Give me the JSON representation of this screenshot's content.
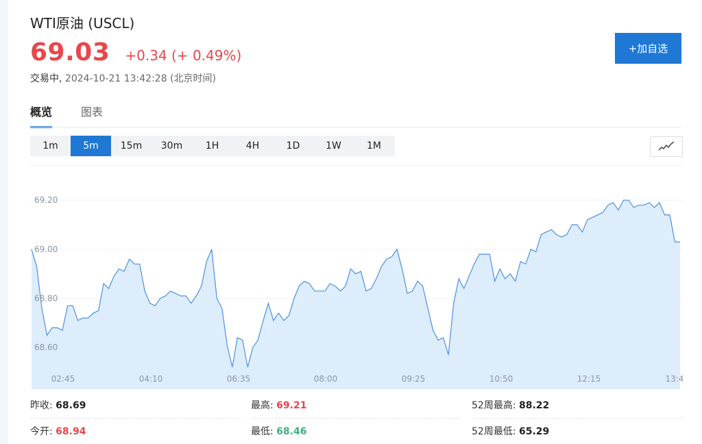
{
  "header": {
    "title": "WTI原油 (USCL)",
    "price": "69.03",
    "change": "+0.34 (+ 0.49%)",
    "status_label": "交易中,",
    "timestamp": "2024-10-21 13:42:28 (北京时间)",
    "add_button": "+加自选"
  },
  "tabs": [
    {
      "label": "概览",
      "active": true
    },
    {
      "label": "图表",
      "active": false
    }
  ],
  "intervals": [
    {
      "label": "1m",
      "active": false
    },
    {
      "label": "5m",
      "active": true
    },
    {
      "label": "15m",
      "active": false
    },
    {
      "label": "30m",
      "active": false
    },
    {
      "label": "1H",
      "active": false
    },
    {
      "label": "4H",
      "active": false
    },
    {
      "label": "1D",
      "active": false
    },
    {
      "label": "1W",
      "active": false
    },
    {
      "label": "1M",
      "active": false
    }
  ],
  "chart_data": {
    "type": "area",
    "x_ticks": [
      "02:45",
      "04:10",
      "06:35",
      "08:00",
      "09:25",
      "10:50",
      "12:15",
      "13:4"
    ],
    "y_ticks": [
      "69.20",
      "69.00",
      "68.80",
      "68.60"
    ],
    "ylim": [
      68.43,
      69.34
    ],
    "line_color": "#4a90e2",
    "fill_color": "#deedfb",
    "grid": true,
    "values": [
      69.0,
      68.93,
      68.76,
      68.65,
      68.68,
      68.68,
      68.67,
      68.77,
      68.77,
      68.71,
      68.72,
      68.72,
      68.74,
      68.75,
      68.86,
      68.84,
      68.89,
      68.92,
      68.91,
      68.96,
      68.94,
      68.94,
      68.83,
      68.78,
      68.77,
      68.8,
      68.81,
      68.83,
      68.82,
      68.81,
      68.81,
      68.78,
      68.81,
      68.85,
      68.95,
      69.0,
      68.8,
      68.76,
      68.61,
      68.52,
      68.64,
      68.63,
      68.52,
      68.6,
      68.63,
      68.71,
      68.78,
      68.71,
      68.74,
      68.71,
      68.73,
      68.8,
      68.85,
      68.87,
      68.86,
      68.83,
      68.83,
      68.83,
      68.86,
      68.85,
      68.83,
      68.85,
      68.92,
      68.9,
      68.91,
      68.83,
      68.84,
      68.88,
      68.93,
      68.96,
      68.97,
      69.0,
      68.92,
      68.82,
      68.83,
      68.87,
      68.85,
      68.76,
      68.67,
      68.63,
      68.64,
      68.57,
      68.78,
      68.88,
      68.84,
      68.89,
      68.94,
      68.98,
      68.98,
      68.98,
      68.87,
      68.92,
      68.88,
      68.9,
      68.87,
      68.95,
      68.94,
      69.0,
      68.99,
      69.06,
      69.07,
      69.08,
      69.06,
      69.05,
      69.06,
      69.1,
      69.1,
      69.07,
      69.12,
      69.13,
      69.14,
      69.15,
      69.18,
      69.19,
      69.16,
      69.2,
      69.2,
      69.17,
      69.18,
      69.18,
      69.19,
      69.17,
      69.19,
      69.14,
      69.14,
      69.03,
      69.03
    ]
  },
  "stats": {
    "prev_close_label": "昨收:",
    "prev_close": "68.69",
    "open_label": "今开:",
    "open": "68.94",
    "high_label": "最高:",
    "high": "69.21",
    "low_label": "最低:",
    "low": "68.46",
    "wk52_high_label": "52周最高:",
    "wk52_high": "88.22",
    "wk52_low_label": "52周最低:",
    "wk52_low": "65.29"
  }
}
